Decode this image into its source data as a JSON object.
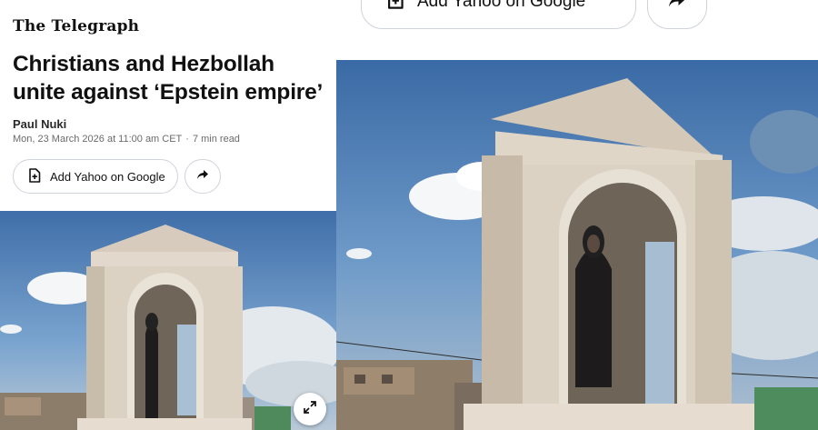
{
  "article": {
    "publication": "The Telegraph",
    "headline": "Christians and Hezbollah unite against ‘Epstein empire’",
    "author": "Paul Nuki",
    "date": "Mon, 23 March 2026 at 11:00 am CET",
    "separator": "·",
    "read_time": "7 min read",
    "add_label": "Add Yahoo on Google"
  },
  "right_panel": {
    "add_label": "Add Yahoo on Google"
  },
  "icons": {
    "add": "add-document-icon",
    "share": "share-arrow-icon",
    "expand": "expand-icon"
  },
  "colors": {
    "sky": "#4e7fb8",
    "shrine_stone": "#dcd2c4",
    "pill_border": "#cfd3da"
  }
}
